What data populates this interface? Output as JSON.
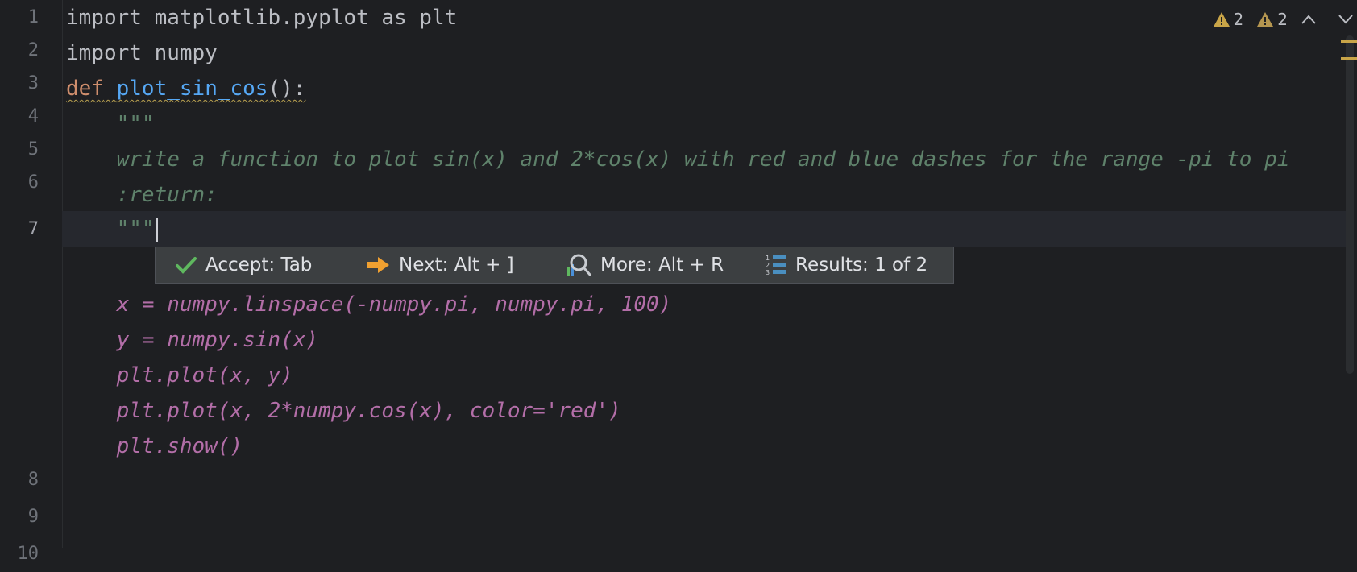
{
  "gutter": {
    "line_numbers": [
      "1",
      "2",
      "3",
      "4",
      "5",
      "6",
      "7",
      "8",
      "9",
      "10"
    ]
  },
  "code": {
    "l1": {
      "text": "import matplotlib.pyplot as plt"
    },
    "l2": {
      "text": "import numpy"
    },
    "l3": {
      "kw": "def",
      "space": " ",
      "fn": "plot_sin_cos",
      "rest": "():"
    },
    "l4": {
      "text": "    \"\"\""
    },
    "l5": {
      "text": "    write a function to plot sin(x) and 2*cos(x) with red and blue dashes for the range -pi to pi"
    },
    "l6": {
      "text": "    :return:"
    },
    "l7": {
      "text": "    \"\"\""
    }
  },
  "suggestion": {
    "lines": [
      "    x = numpy.linspace(-numpy.pi, numpy.pi, 100)",
      "    y = numpy.sin(x)",
      "    plt.plot(x, y)",
      "    plt.plot(x, 2*numpy.cos(x), color='red')",
      "    plt.show()"
    ]
  },
  "popup": {
    "accept": "Accept: Tab",
    "next": "Next: Alt + ]",
    "more": "More: Alt + R",
    "results": "Results: 1 of 2"
  },
  "toolbar": {
    "warnings_a": "2",
    "warnings_b": "2"
  },
  "colors": {
    "accent_warning": "#c9a548",
    "ghost_text": "#b36ea8",
    "docstring": "#5f826b",
    "keyword": "#cf8e6d",
    "function": "#56a8f5"
  },
  "icons": [
    "warning-icon",
    "check-icon",
    "arrow-right-icon",
    "search-chart-icon",
    "numbered-list-icon",
    "chevron-up-icon",
    "chevron-down-icon"
  ]
}
